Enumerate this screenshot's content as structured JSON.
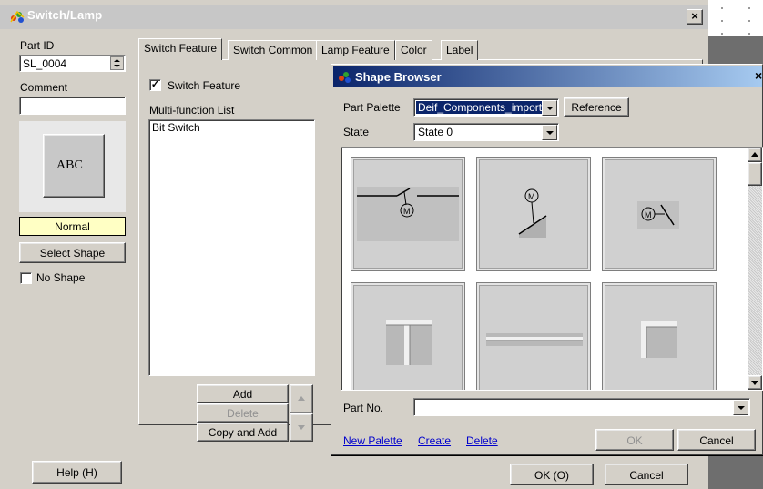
{
  "main_window": {
    "title": "Switch/Lamp",
    "close_label": "×"
  },
  "left_panel": {
    "part_id_label": "Part ID",
    "part_id_value": "SL_0004",
    "comment_label": "Comment",
    "comment_value": "",
    "preview_text": "ABC",
    "state_label": "Normal",
    "select_shape_label": "Select Shape",
    "no_shape_label": "No Shape",
    "no_shape_checked": false,
    "help_label": "Help (H)"
  },
  "tabs": [
    {
      "label": "Switch Feature",
      "active": true
    },
    {
      "label": "Switch Common",
      "active": false
    },
    {
      "label": "Lamp Feature",
      "active": false
    },
    {
      "label": "Color",
      "active": false
    },
    {
      "label": "Label",
      "active": false
    }
  ],
  "switch_feature": {
    "checkbox_label": "Switch Feature",
    "checked": true,
    "list_label": "Multi-function List",
    "list_items": [
      "Bit Switch"
    ],
    "add_label": "Add",
    "delete_label": "Delete",
    "copy_add_label": "Copy and Add"
  },
  "footer": {
    "ok_label": "OK (O)",
    "cancel_label": "Cancel"
  },
  "shape_browser": {
    "title": "Shape Browser",
    "close_label": "×",
    "part_palette_label": "Part Palette",
    "part_palette_value": "Deif_Components_import",
    "reference_label": "Reference",
    "state_label": "State",
    "state_value": "State 0",
    "grid_shapes": [
      {
        "name": "motor-switch-horizontal-shape",
        "glyph": "M"
      },
      {
        "name": "motor-switch-diagonal-shape",
        "glyph": "M"
      },
      {
        "name": "motor-switch-small-shape",
        "glyph": "M"
      },
      {
        "name": "tee-junction-shape",
        "glyph": ""
      },
      {
        "name": "horizontal-line-shape",
        "glyph": ""
      },
      {
        "name": "corner-shape",
        "glyph": ""
      }
    ],
    "part_no_label": "Part No.",
    "part_no_value": "",
    "new_palette_label": "New Palette",
    "create_label": "Create",
    "delete_label": "Delete",
    "ok_label": "OK",
    "cancel_label": "Cancel"
  }
}
